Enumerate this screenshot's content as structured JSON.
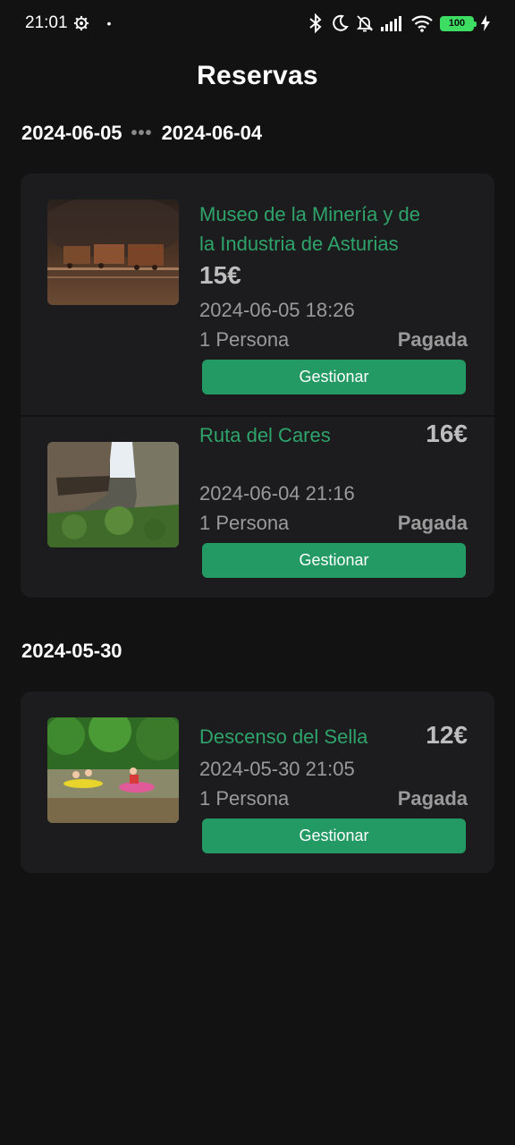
{
  "status_bar": {
    "time": "21:01",
    "battery": "100"
  },
  "header": {
    "title": "Reservas"
  },
  "groups": [
    {
      "start": "2024-06-05",
      "separator": "•••",
      "end": "2024-06-04",
      "bookings": [
        {
          "name_line1": "Museo de la Minería y de",
          "name_line2": "la Industria de Asturias",
          "price": "15€",
          "datetime": "2024-06-05 18:26",
          "people": "1 Persona",
          "status": "Pagada",
          "button": "Gestionar"
        },
        {
          "name_line1": "Ruta del Cares",
          "price": "16€",
          "datetime": "2024-06-04 21:16",
          "people": "1 Persona",
          "status": "Pagada",
          "button": "Gestionar"
        }
      ]
    },
    {
      "start": "2024-05-30",
      "bookings": [
        {
          "name_line1": "Descenso del Sella",
          "price": "12€",
          "datetime": "2024-05-30 21:05",
          "people": "1 Persona",
          "status": "Pagada",
          "button": "Gestionar"
        }
      ]
    }
  ],
  "colors": {
    "background": "#121212",
    "card": "#1c1c1e",
    "accent": "#239a63",
    "title_green": "#2ea36a"
  }
}
